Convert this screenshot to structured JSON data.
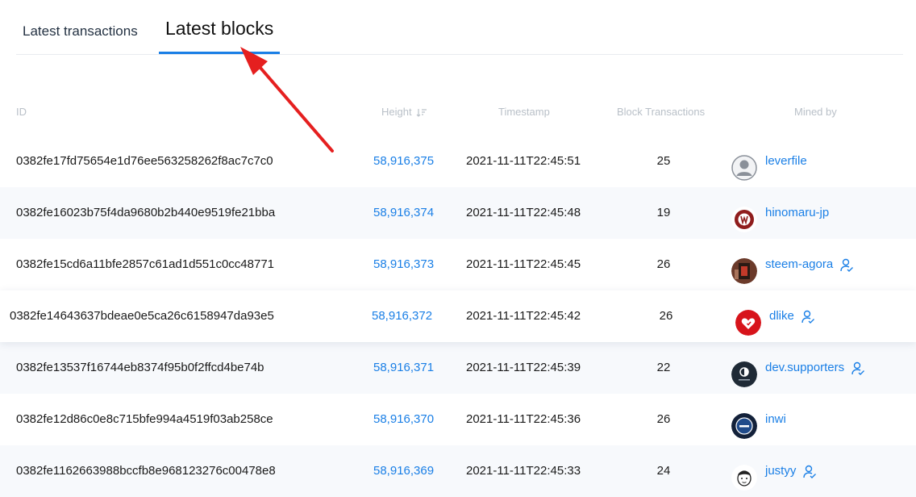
{
  "tabs": [
    {
      "label": "Latest transactions",
      "active": false
    },
    {
      "label": "Latest blocks",
      "active": true
    }
  ],
  "colors": {
    "accent": "#1a7fe6",
    "annotation_arrow": "#e51f1f"
  },
  "table": {
    "headers": {
      "id": "ID",
      "height": "Height",
      "timestamp": "Timestamp",
      "block_transactions": "Block Transactions",
      "mined_by": "Mined by"
    },
    "rows": [
      {
        "id": "0382fe17fd75654e1d76ee563258262f8ac7c7c0",
        "height": "58,916,375",
        "timestamp": "2021-11-11T22:45:51",
        "block_transactions": "25",
        "mined_by": "leverfile",
        "avatar": "default-user-icon",
        "witness_vote_icon": false
      },
      {
        "id": "0382fe16023b75f4da9680b2b440e9519fe21bba",
        "height": "58,916,374",
        "timestamp": "2021-11-11T22:45:48",
        "block_transactions": "19",
        "mined_by": "hinomaru-jp",
        "avatar": "hinomaru-avatar",
        "witness_vote_icon": false
      },
      {
        "id": "0382fe15cd6a11bfe2857c61ad1d551c0cc48771",
        "height": "58,916,373",
        "timestamp": "2021-11-11T22:45:45",
        "block_transactions": "26",
        "mined_by": "steem-agora",
        "avatar": "steem-agora-avatar",
        "witness_vote_icon": true
      },
      {
        "id": "0382fe14643637bdeae0e5ca26c6158947da93e5",
        "height": "58,916,372",
        "timestamp": "2021-11-11T22:45:42",
        "block_transactions": "26",
        "mined_by": "dlike",
        "avatar": "dlike-heart-avatar",
        "witness_vote_icon": true
      },
      {
        "id": "0382fe13537f16744eb8374f95b0f2ffcd4be74b",
        "height": "58,916,371",
        "timestamp": "2021-11-11T22:45:39",
        "block_transactions": "22",
        "mined_by": "dev.supporters",
        "avatar": "dev-supporters-avatar",
        "witness_vote_icon": true
      },
      {
        "id": "0382fe12d86c0e8c715bfe994a4519f03ab258ce",
        "height": "58,916,370",
        "timestamp": "2021-11-11T22:45:36",
        "block_transactions": "26",
        "mined_by": "inwi",
        "avatar": "inwi-avatar",
        "witness_vote_icon": false
      },
      {
        "id": "0382fe1162663988bccfb8e968123276c00478e8",
        "height": "58,916,369",
        "timestamp": "2021-11-11T22:45:33",
        "block_transactions": "24",
        "mined_by": "justyy",
        "avatar": "justyy-avatar",
        "witness_vote_icon": true
      }
    ]
  }
}
